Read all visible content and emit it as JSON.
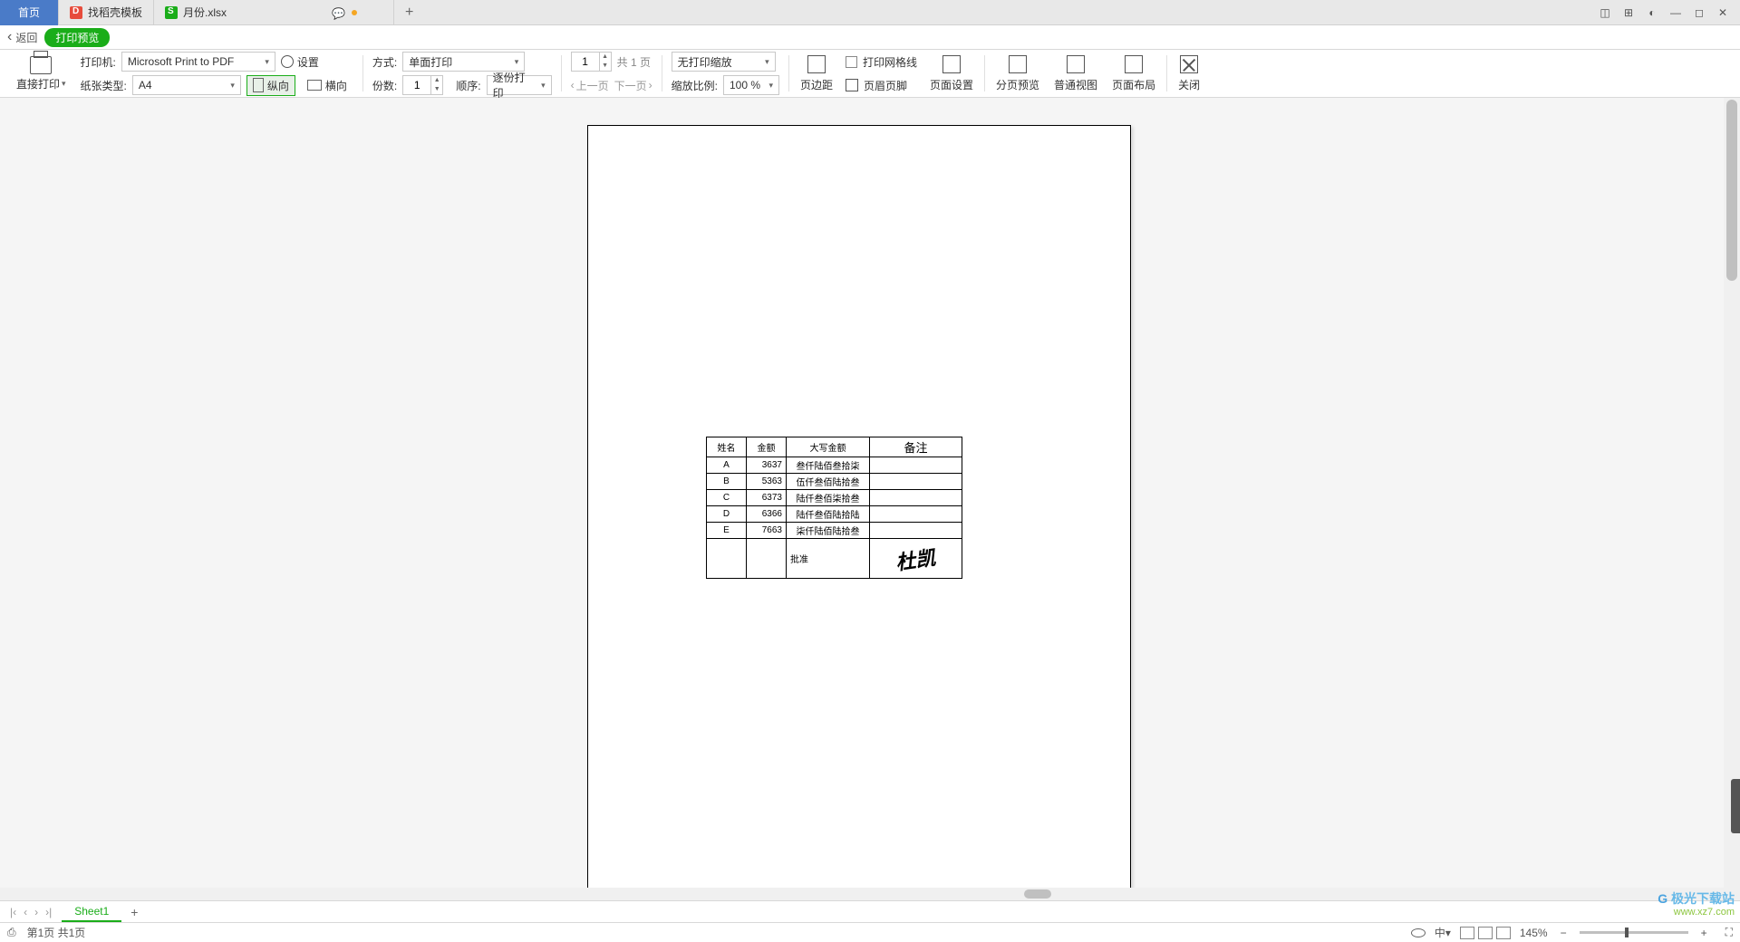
{
  "tabs": {
    "home": "首页",
    "templates": "找稻壳模板",
    "file": "月份.xlsx"
  },
  "back": {
    "label": "返回",
    "pill": "打印预览"
  },
  "toolbar": {
    "direct_print": "直接打印",
    "printer_label": "打印机:",
    "printer_value": "Microsoft Print to PDF",
    "settings": "设置",
    "paper_label": "纸张类型:",
    "paper_value": "A4",
    "orient_portrait": "纵向",
    "orient_landscape": "横向",
    "mode_label": "方式:",
    "mode_value": "单面打印",
    "copies_label": "份数:",
    "copies_value": "1",
    "order_label": "顺序:",
    "order_value": "逐份打印",
    "page_current": "1",
    "page_total": "共 1 页",
    "prev": "上一页",
    "next": "下一页",
    "scale_label": "缩放比例:",
    "scale_value": "100 %",
    "scale_mode": "无打印缩放",
    "margins": "页边距",
    "gridlines": "打印网格线",
    "header_footer": "页眉页脚",
    "page_setup": "页面设置",
    "page_break": "分页预览",
    "normal_view": "普通视图",
    "page_layout": "页面布局",
    "close": "关闭"
  },
  "table": {
    "headers": [
      "姓名",
      "金额",
      "大写金额",
      "备注"
    ],
    "rows": [
      [
        "A",
        "3637",
        "叁仟陆佰叁拾柒",
        ""
      ],
      [
        "B",
        "5363",
        "伍仟叁佰陆拾叁",
        ""
      ],
      [
        "C",
        "6373",
        "陆仟叁佰柒拾叁",
        ""
      ],
      [
        "D",
        "6366",
        "陆仟叁佰陆拾陆",
        ""
      ],
      [
        "E",
        "7663",
        "柒仟陆佰陆拾叁",
        ""
      ]
    ],
    "approve": "批准"
  },
  "sheet": {
    "name": "Sheet1"
  },
  "status": {
    "page_info": "第1页 共1页",
    "lang": "中",
    "zoom": "145%"
  },
  "watermark": {
    "brand": "极光下载站",
    "url": "www.xz7.com"
  }
}
